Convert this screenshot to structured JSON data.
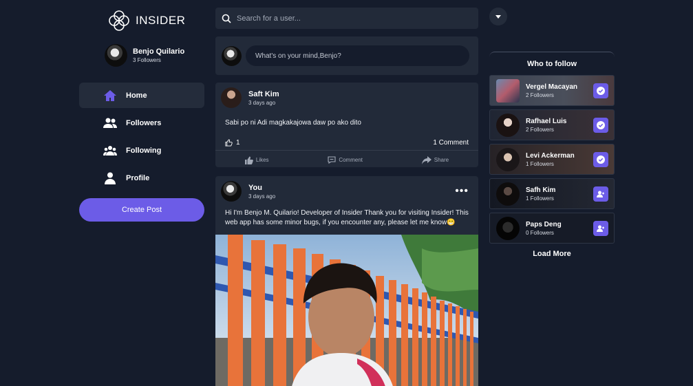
{
  "app": {
    "title": "INSIDER"
  },
  "user": {
    "name": "Benjo Quilario",
    "followers": "3 Followers"
  },
  "nav": {
    "items": [
      {
        "label": "Home",
        "icon": "home-icon",
        "active": true
      },
      {
        "label": "Followers",
        "icon": "followers-icon"
      },
      {
        "label": "Following",
        "icon": "following-icon"
      },
      {
        "label": "Profile",
        "icon": "profile-icon"
      }
    ],
    "create_label": "Create Post"
  },
  "search": {
    "placeholder": "Search for a user..."
  },
  "composer": {
    "placeholder": "What's on your mind,Benjo?"
  },
  "posts": [
    {
      "author": "Saft Kim",
      "time": "3 days ago",
      "text": "Sabi po ni Adi magkakajowa daw po ako dito",
      "likes": "1",
      "comments": "1 Comment",
      "actions": {
        "like": "Likes",
        "comment": "Comment",
        "share": "Share"
      }
    },
    {
      "author": "You",
      "time": "3 days ago",
      "text": "Hi I'm Benjo M. Quilario! Developer of Insider  Thank you for visiting Insider! This web app has some minor bugs, if you encounter any, please let me know😁",
      "more_icon": "more-horizontal-icon"
    }
  ],
  "who_to_follow": {
    "title": "Who to follow",
    "people": [
      {
        "name": "Vergel Macayan",
        "followers": "2 Followers",
        "following": true
      },
      {
        "name": "Rafhael Luis",
        "followers": "2 Followers",
        "following": true
      },
      {
        "name": "Levi Ackerman",
        "followers": "1 Followers",
        "following": true
      },
      {
        "name": "Safh Kim",
        "followers": "1 Followers",
        "following": false
      },
      {
        "name": "Paps Deng",
        "followers": "0 Followers",
        "following": false
      }
    ],
    "load_more": "Load More"
  },
  "colors": {
    "background": "#151c2c",
    "card": "#222a39",
    "accent": "#6c5ce7"
  }
}
